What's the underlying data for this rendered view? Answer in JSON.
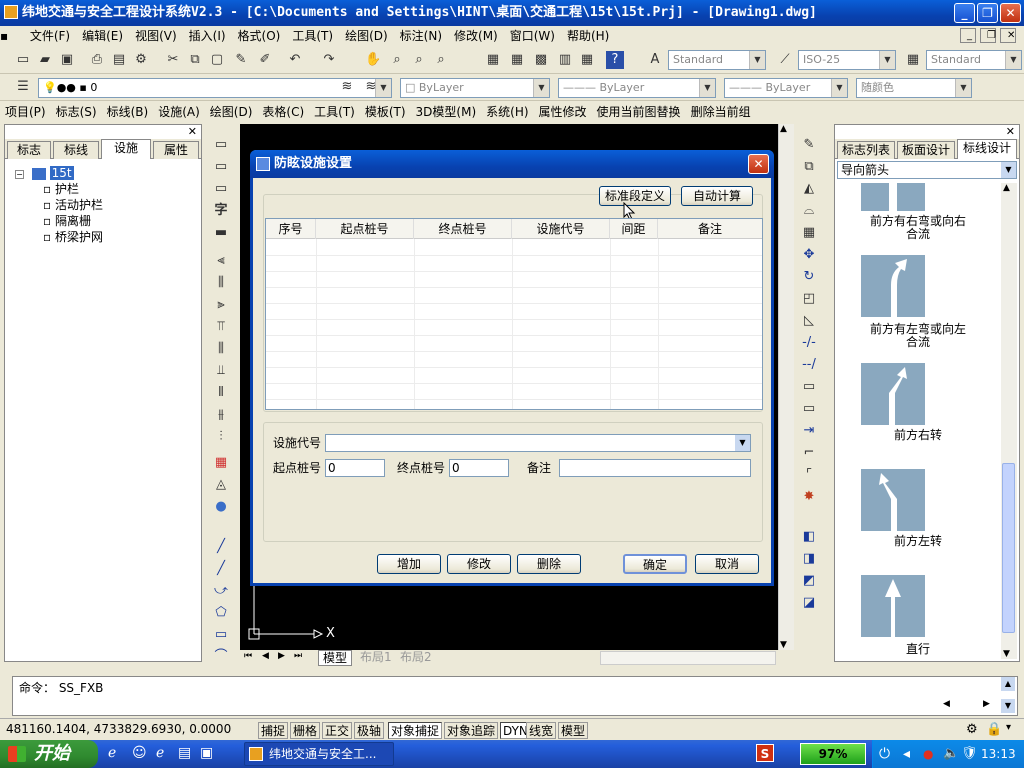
{
  "window": {
    "title": "纬地交通与安全工程设计系统V2.3 - [C:\\Documents and Settings\\HINT\\桌面\\交通工程\\15t\\15t.Prj] - [Drawing1.dwg]"
  },
  "menu": [
    "文件(F)",
    "编辑(E)",
    "视图(V)",
    "插入(I)",
    "格式(O)",
    "工具(T)",
    "绘图(D)",
    "标注(N)",
    "修改(M)",
    "窗口(W)",
    "帮助(H)"
  ],
  "toolbar": {
    "text_style": "Standard",
    "dim_style": "ISO-25",
    "table_style": "Standard",
    "layer": "0",
    "color": "ByLayer",
    "linetype": "ByLayer",
    "lineweight": "ByLayer",
    "plot_style": "随颜色"
  },
  "menu2": [
    "项目(P)",
    "标志(S)",
    "标线(B)",
    "设施(A)",
    "绘图(D)",
    "表格(C)",
    "工具(T)",
    "模板(T)",
    "3D模型(M)",
    "系统(H)",
    "属性修改",
    "使用当前图替换",
    "删除当前组"
  ],
  "left_panel": {
    "tabs": [
      "标志",
      "标线",
      "设施",
      "属性"
    ],
    "active_tab": "设施",
    "tree_root": "15t",
    "tree_items": [
      "护栏",
      "活动护栏",
      "隔离栅",
      "桥梁护网"
    ]
  },
  "right_panel": {
    "tabs": [
      "标志列表",
      "板面设计",
      "标线设计"
    ],
    "active_tab": "标线设计",
    "dropdown": "导向箭头",
    "items": [
      {
        "label1": "前方有右弯或向右",
        "label2": "合流"
      },
      {
        "label1": "前方有左弯或向左",
        "label2": "合流"
      },
      {
        "label1": "前方右转",
        "label2": ""
      },
      {
        "label1": "前方左转",
        "label2": ""
      },
      {
        "label1": "直行",
        "label2": ""
      }
    ]
  },
  "drawing": {
    "axis_x": "X",
    "layout_tabs": [
      "模型",
      "布局1",
      "布局2"
    ]
  },
  "dialog": {
    "title": "防眩设施设置",
    "btn_standard": "标准段定义",
    "btn_auto": "自动计算",
    "columns": [
      "序号",
      "起点桩号",
      "终点桩号",
      "设施代号",
      "间距",
      "备注"
    ],
    "label_code": "设施代号",
    "label_start": "起点桩号",
    "start_value": "0",
    "label_end": "终点桩号",
    "end_value": "0",
    "label_note": "备注",
    "btn_add": "增加",
    "btn_modify": "修改",
    "btn_delete": "删除",
    "btn_ok": "确定",
    "btn_cancel": "取消"
  },
  "command": {
    "line": "命令： SS_FXB"
  },
  "status": {
    "coords": "481160.1404, 4733829.6930, 0.0000",
    "buttons": [
      "捕捉",
      "栅格",
      "正交",
      "极轴",
      "对象捕捉",
      "对象追踪",
      "DYN",
      "线宽",
      "模型"
    ]
  },
  "taskbar": {
    "start": "开始",
    "task": "纬地交通与安全工...",
    "battery": "97%",
    "time": "13:13"
  }
}
